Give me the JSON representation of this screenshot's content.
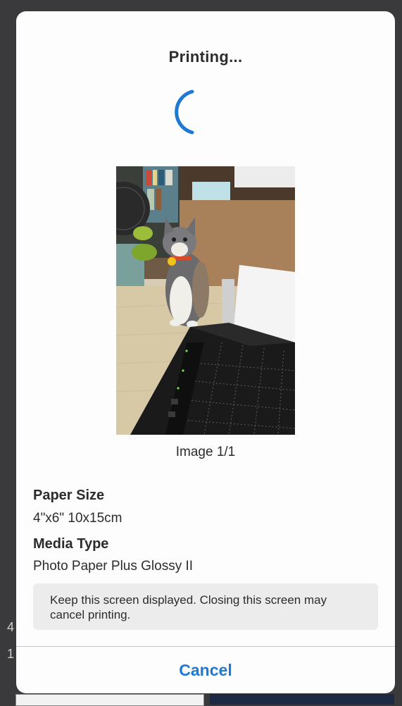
{
  "dialog": {
    "title": "Printing...",
    "spinner_color": "#1f78d1",
    "preview": {
      "subject": "photo-thumbnail",
      "caption": "Image 1/1"
    },
    "paper_size": {
      "label": "Paper Size",
      "value": "4\"x6\" 10x15cm"
    },
    "media_type": {
      "label": "Media Type",
      "value": "Photo Paper Plus Glossy II"
    },
    "notice": "Keep this screen displayed. Closing this screen may cancel printing.",
    "cancel_label": "Cancel",
    "accent_color": "#1f78d1"
  },
  "background": {
    "peek_1": "4",
    "peek_2": "1"
  }
}
